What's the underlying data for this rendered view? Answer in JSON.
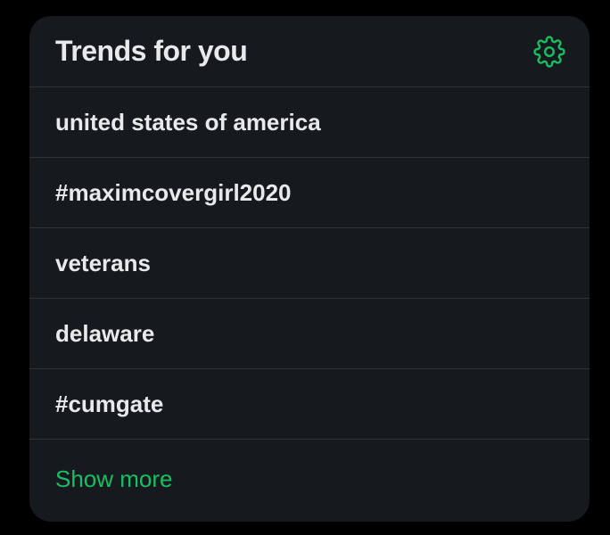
{
  "widget": {
    "title": "Trends for you",
    "settings_icon": "gear-icon",
    "accent_color": "#17bf63",
    "trends": [
      {
        "label": "united states of america"
      },
      {
        "label": "#maximcovergirl2020"
      },
      {
        "label": "veterans"
      },
      {
        "label": "delaware"
      },
      {
        "label": "#cumgate"
      }
    ],
    "show_more_label": "Show more"
  }
}
